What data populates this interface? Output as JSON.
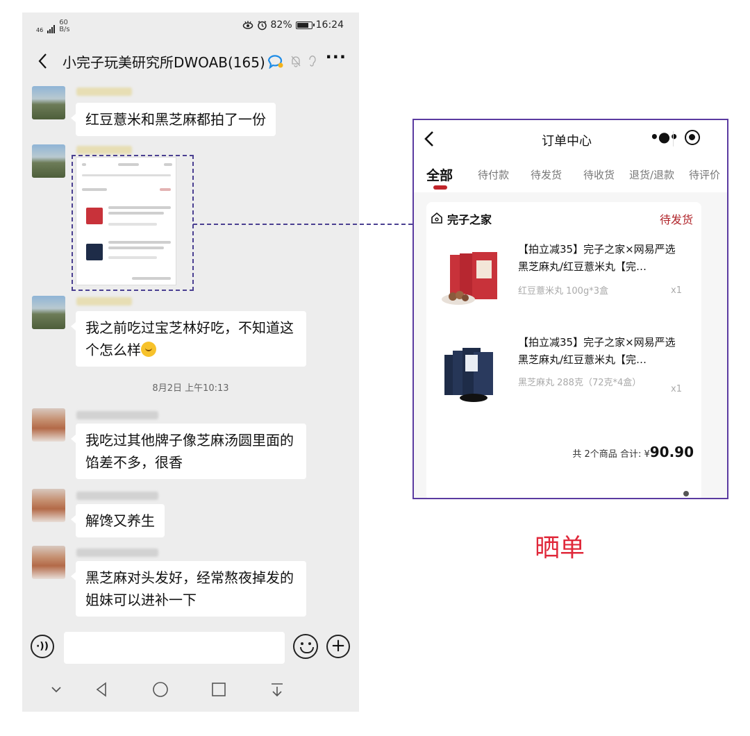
{
  "status_bar": {
    "network_type": "46",
    "net_speed_value": "60",
    "net_speed_unit": "B/s",
    "battery": "82%",
    "time": "16:24"
  },
  "chat": {
    "title": "小完子玩美研究所DWOAB(165)",
    "messages": [
      {
        "text": "红豆薏米和黑芝麻都拍了一份"
      },
      {
        "text": "我之前吃过宝芝林好吃，不知道这个怎么样"
      },
      {
        "text": "我吃过其他牌子像芝麻汤圆里面的馅差不多，很香"
      },
      {
        "text": "解馋又养生"
      },
      {
        "text": "黑芝麻对头发好，经常熬夜掉发的姐妹可以进补一下"
      }
    ],
    "timestamp": "8月2日 上午10:13"
  },
  "order": {
    "title": "订单中心",
    "tabs": [
      "全部",
      "待付款",
      "待发货",
      "待收货",
      "退货/退款",
      "待评价"
    ],
    "shop_name": "完子之家",
    "status": "待发货",
    "items": [
      {
        "title": "【拍立减35】完子之家×网易严选黑芝麻丸/红豆薏米丸【完…",
        "spec": "红豆薏米丸 100g*3盒",
        "qty": "x1",
        "color": "#c8323a"
      },
      {
        "title": "【拍立减35】完子之家×网易严选黑芝麻丸/红豆薏米丸【完…",
        "spec": "黑芝麻丸 288克（72克*4盒）",
        "qty": "x1",
        "color": "#1e2c48"
      }
    ],
    "total_prefix": "共 2个商品 合计: ¥",
    "total_amount": "90.90"
  },
  "caption": "晒单",
  "colors": {
    "accent": "#c0242a",
    "frame": "#4a3f91",
    "caption": "#e0283a"
  }
}
